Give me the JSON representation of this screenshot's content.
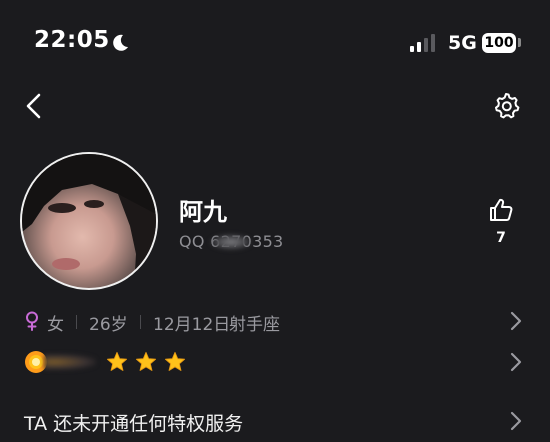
{
  "status_bar": {
    "time": "22:05",
    "network": "5G",
    "battery": "100"
  },
  "nav": {
    "back_icon": "chevron-left-icon",
    "settings_icon": "gear-icon"
  },
  "profile": {
    "nickname": "阿九",
    "qq_number": "QQ        6270353",
    "likes": "7"
  },
  "info": {
    "gender": "女",
    "age": "26岁",
    "birthday": "12月12日",
    "zodiac": "射手座",
    "gender_color": "#c86bd6"
  },
  "level": {
    "stars": 3,
    "star_color": "#ffc21a",
    "sun_color": "#ff9c1a"
  },
  "vip": {
    "text": "TA 还未开通任何特权服务"
  }
}
